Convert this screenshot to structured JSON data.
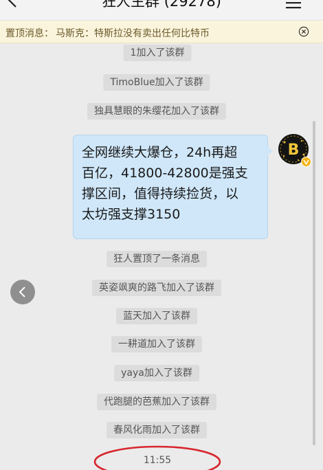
{
  "header": {
    "title": "狂人主群 (29278)",
    "back_icon": "chevron-left-icon",
    "menu_icon": "hamburger-menu-icon"
  },
  "pinned": {
    "prefix": "置顶消息：",
    "text": "马斯克：特斯拉没有卖出任何比特币",
    "close_icon": "close-circle-icon"
  },
  "system_messages": [
    "1加入了该群",
    "TimoBlue加入了该群",
    "独具慧眼的朱缨花加入了该群",
    "狂人置顶了一条消息",
    "英姿飒爽的路飞加入了该群",
    "蓝天加入了该群",
    "一耕道加入了该群",
    "yaya加入了该群",
    "代跑腿的芭蕉加入了该群",
    "春风化雨加入了该群"
  ],
  "message": {
    "lines": [
      "全网继续大爆仓，24h再超",
      "百亿，41800-42800是强支",
      "撑区间，值得持续捡货，以",
      "太坊强支撑3150"
    ],
    "avatar_icon": "bitcoin-avatar-icon"
  },
  "timestamp": "11:55",
  "colors": {
    "pinned_bg": "#fbf4dc",
    "bubble_bg": "#cfe7f9",
    "annotation_red": "#d8262e"
  }
}
